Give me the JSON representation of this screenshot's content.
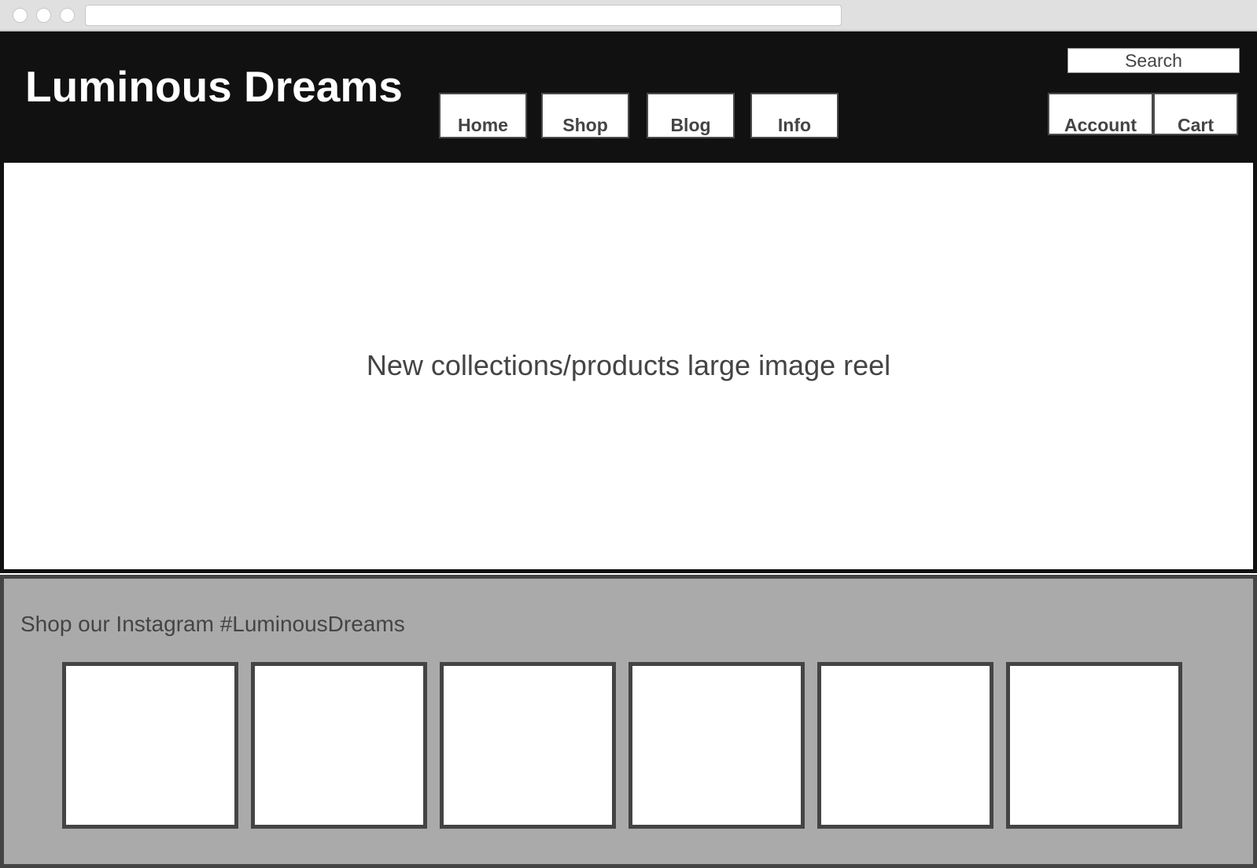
{
  "site": {
    "title": "Luminous Dreams"
  },
  "nav": {
    "items": [
      {
        "label": "Home"
      },
      {
        "label": "Shop"
      },
      {
        "label": "Blog"
      },
      {
        "label": "Info"
      }
    ]
  },
  "header": {
    "search_label": "Search",
    "account_label": "Account",
    "cart_label": "Cart"
  },
  "hero": {
    "text": "New collections/products large image reel"
  },
  "instagram": {
    "title": "Shop our Instagram #LuminousDreams",
    "tile_count": 6
  },
  "colors": {
    "header_bg": "#111111",
    "section_bg": "#aaaaaa",
    "border": "#444444",
    "text": "#444444"
  }
}
